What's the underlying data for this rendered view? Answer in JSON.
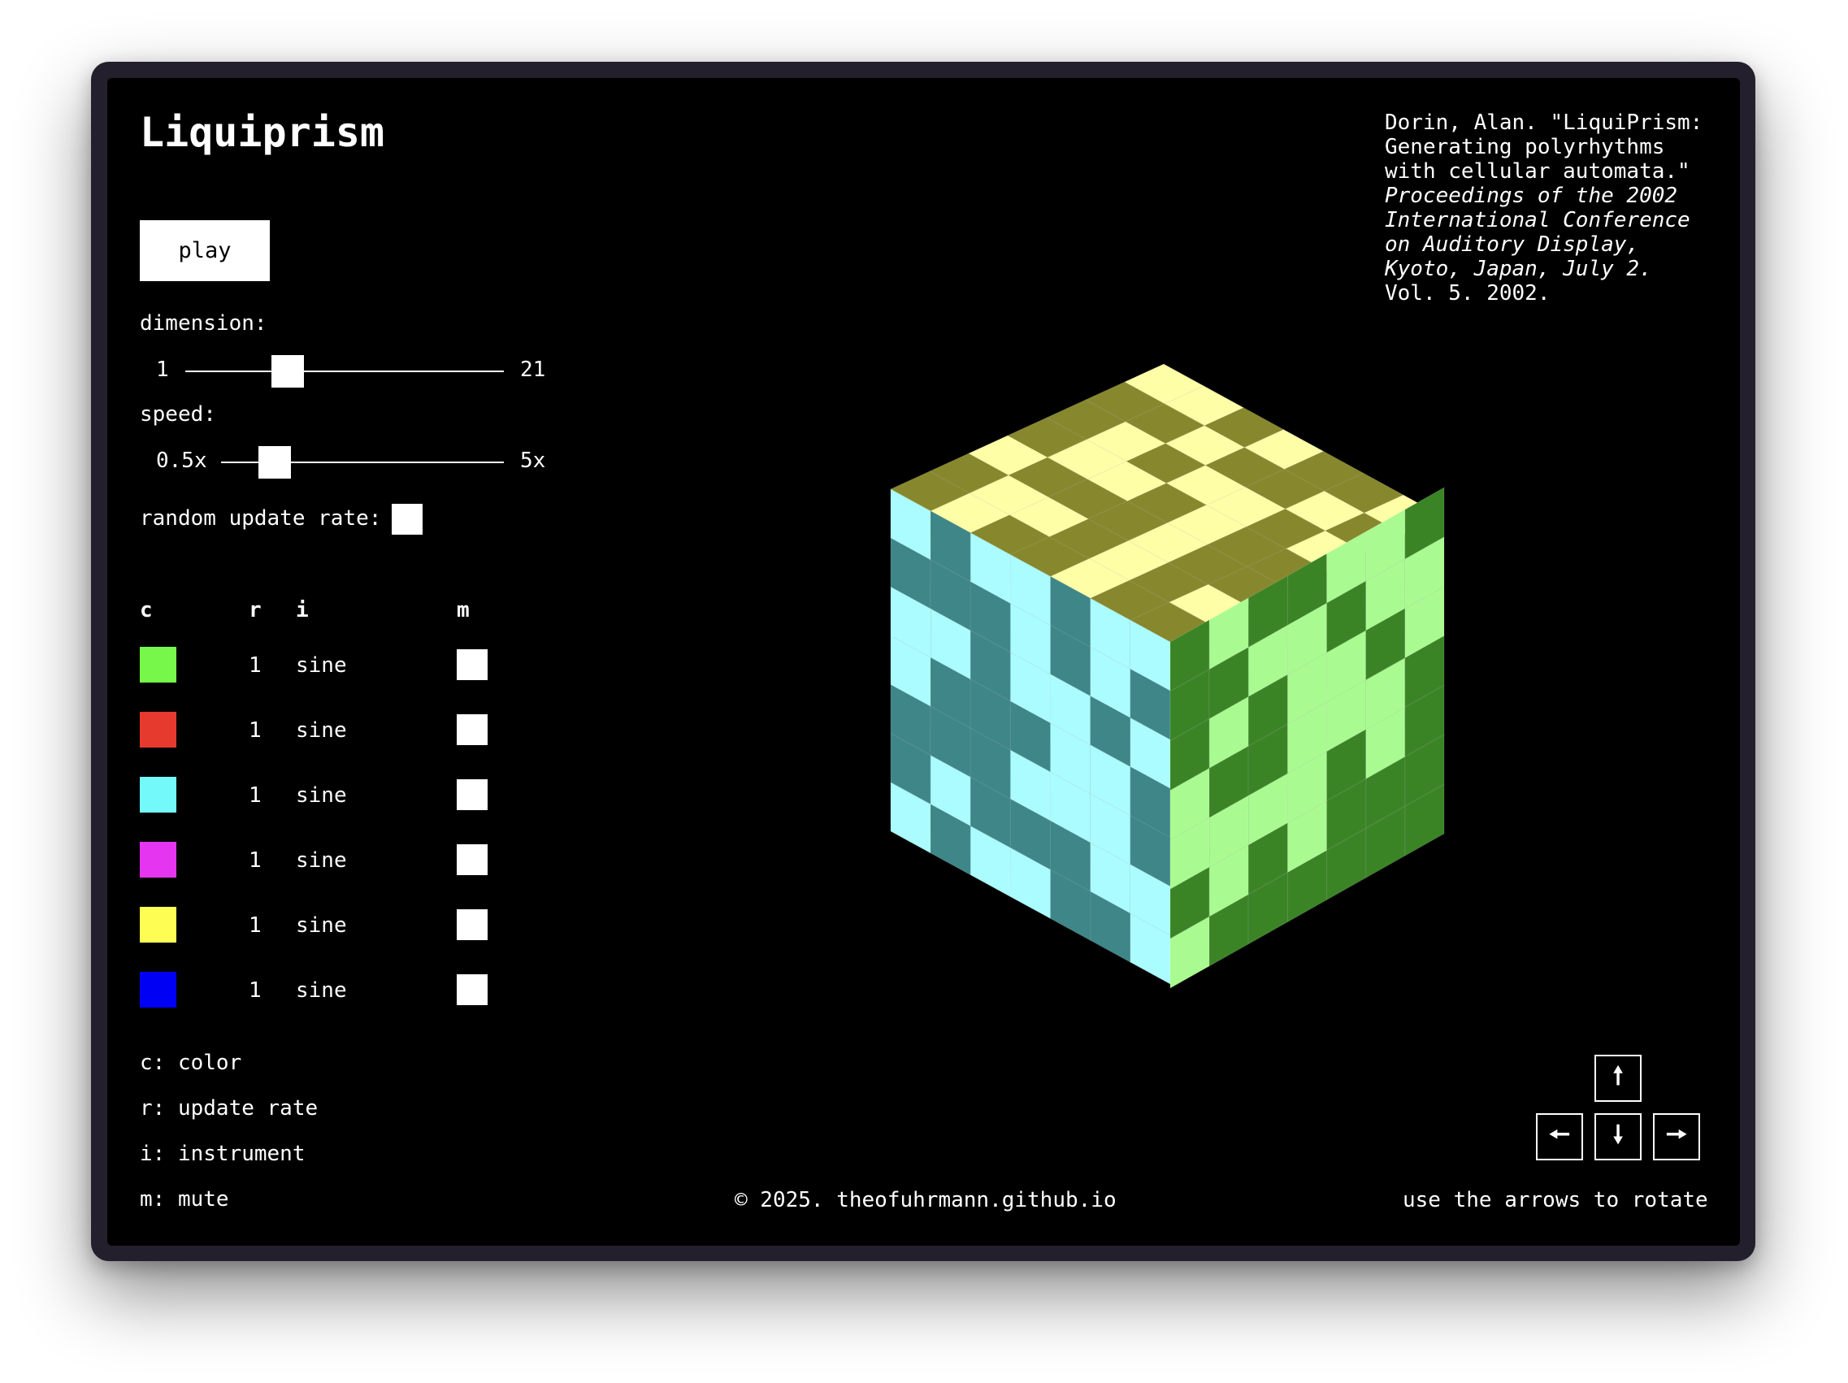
{
  "app": {
    "title": "Liquiprism",
    "play_label": "play"
  },
  "controls": {
    "dimension_label": "dimension:",
    "dimension_min": "1",
    "dimension_max": "21",
    "dimension_value": 0.3,
    "speed_label": "speed:",
    "speed_min": "0.5x",
    "speed_max": "5x",
    "speed_value": 0.15,
    "random_update_rate_label": "random update rate:"
  },
  "table": {
    "headers": {
      "c": "c",
      "r": "r",
      "i": "i",
      "m": "m"
    },
    "rows": [
      {
        "color": "#77f74a",
        "rate": "1",
        "instrument": "sine"
      },
      {
        "color": "#e53a2d",
        "rate": "1",
        "instrument": "sine"
      },
      {
        "color": "#74f9fb",
        "rate": "1",
        "instrument": "sine"
      },
      {
        "color": "#e635f0",
        "rate": "1",
        "instrument": "sine"
      },
      {
        "color": "#fdfd54",
        "rate": "1",
        "instrument": "sine"
      },
      {
        "color": "#0000f5",
        "rate": "1",
        "instrument": "sine"
      }
    ]
  },
  "legend": {
    "c": "c: color",
    "r": "r: update rate",
    "i": "i: instrument",
    "m": "m: mute"
  },
  "citation": {
    "l1": "Dorin, Alan. \"LiquiPrism:",
    "l2": "Generating polyrhythms",
    "l3": "with cellular automata.\"",
    "l4": "Proceedings of the 2002",
    "l5": "International Conference",
    "l6": "on Auditory Display,",
    "l7": "Kyoto, Japan, July 2.",
    "l8": "Vol. 5. 2002."
  },
  "footer": {
    "copyright": "© 2025. theofuhrmann.github.io",
    "rotate_hint": "use the arrows to rotate"
  },
  "arrows": {
    "up": "🠕",
    "left": "🠔",
    "down": "🠗",
    "right": "🠖"
  },
  "cube": {
    "size": 7,
    "top_colors": {
      "on": "#fefea6",
      "off": "#87872d"
    },
    "left_colors": {
      "on": "#aafcff",
      "off": "#3e8688"
    },
    "right_colors": {
      "on": "#a9fb91",
      "off": "#3b8426"
    },
    "top": [
      "0010001",
      "1101101",
      "0101010",
      "0000101",
      "1111100",
      "0000010",
      "0100101"
    ],
    "left": [
      "1011011",
      "0001010",
      "1101101",
      "1000110",
      "0001110",
      "0100011",
      "1011001"
    ],
    "right": [
      "0100110",
      "0011011",
      "0101101",
      "1001110",
      "1111010",
      "0101000",
      "1000000"
    ]
  }
}
